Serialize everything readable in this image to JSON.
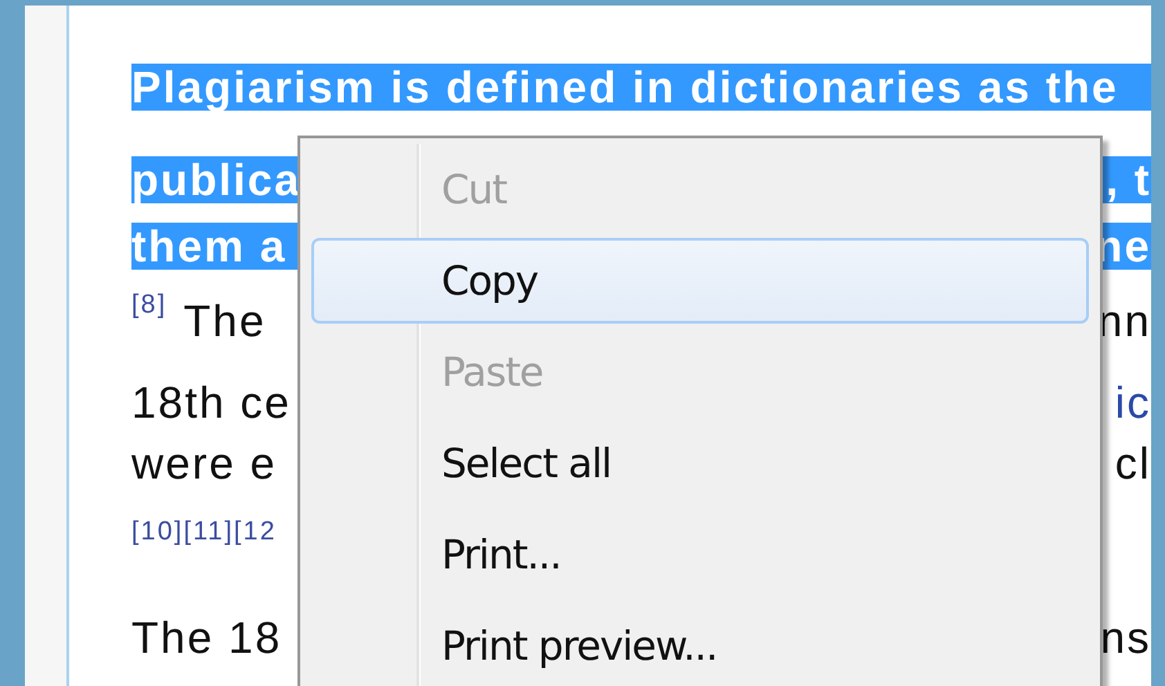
{
  "lines": [
    {
      "kind": "text",
      "selected": true,
      "left": "Plagiarism is defined in dictionaries as the"
    },
    {
      "kind": "text",
      "selected": true,
      "left": "publica",
      "right": ", t",
      "right_link": false
    },
    {
      "kind": "text",
      "selected": true,
      "left": "them a",
      "right": "ne",
      "right_link": false
    },
    {
      "kind": "text",
      "selected": false,
      "ref": "[8]",
      "left": "The",
      "right": "nn",
      "right_link": false
    },
    {
      "kind": "text",
      "selected": false,
      "left": "18th ce",
      "right": "ic",
      "right_link": true
    },
    {
      "kind": "text",
      "selected": false,
      "left": "were e",
      "right": "cl",
      "right_link": false
    },
    {
      "kind": "refs",
      "selected": false,
      "left": "[10][11][12"
    },
    {
      "kind": "text",
      "selected": false,
      "left": "The 18",
      "right": "ns",
      "right_link": false
    }
  ],
  "menu": [
    {
      "label": "Cut",
      "disabled": true,
      "selected": false
    },
    {
      "label": "Copy",
      "disabled": false,
      "selected": true
    },
    {
      "label": "Paste",
      "disabled": true,
      "selected": false
    },
    {
      "label": "Select all",
      "disabled": false,
      "selected": false
    },
    {
      "label": "Print...",
      "disabled": false,
      "selected": false
    },
    {
      "label": "Print preview...",
      "disabled": false,
      "selected": false
    }
  ]
}
